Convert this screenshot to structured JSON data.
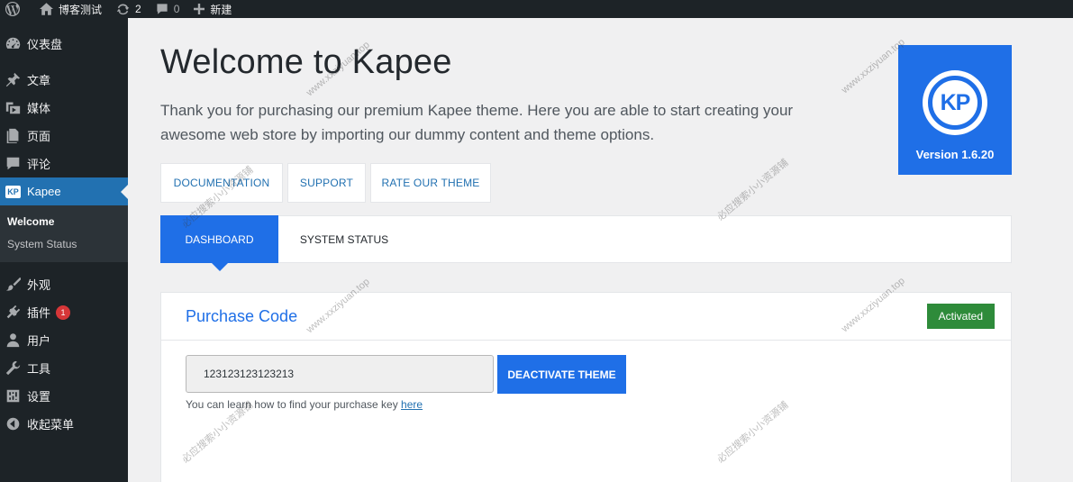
{
  "adminbar": {
    "site_name": "博客测试",
    "updates_count": "2",
    "comments_count": "0",
    "new_label": "新建"
  },
  "sidebar": {
    "items": [
      {
        "label": "仪表盘",
        "icon": "dashboard-icon"
      },
      {
        "label": "文章",
        "icon": "pin-icon"
      },
      {
        "label": "媒体",
        "icon": "media-icon"
      },
      {
        "label": "页面",
        "icon": "page-icon"
      },
      {
        "label": "评论",
        "icon": "comment-icon"
      },
      {
        "label": "Kapee",
        "icon": "kp-icon"
      },
      {
        "label": "外观",
        "icon": "brush-icon"
      },
      {
        "label": "插件",
        "icon": "plugin-icon",
        "badge": "1"
      },
      {
        "label": "用户",
        "icon": "user-icon"
      },
      {
        "label": "工具",
        "icon": "wrench-icon"
      },
      {
        "label": "设置",
        "icon": "settings-icon"
      },
      {
        "label": "收起菜单",
        "icon": "collapse-icon"
      }
    ],
    "kp_mini": "KP",
    "submenu": [
      "Welcome",
      "System Status"
    ]
  },
  "main": {
    "title": "Welcome to Kapee",
    "description": "Thank you for purchasing our premium Kapee theme. Here you are able to start creating your awesome web store by importing our dummy content and theme options.",
    "logo_text": "KP",
    "version": "Version 1.6.20",
    "links": [
      "DOCUMENTATION",
      "SUPPORT",
      "RATE OUR THEME"
    ],
    "tabs": [
      "DASHBOARD",
      "SYSTEM STATUS"
    ],
    "purchase": {
      "title": "Purchase Code",
      "status": "Activated",
      "code": "123123123123213",
      "button": "DEACTIVATE THEME",
      "help_prefix": "You can learn how to find your purchase key ",
      "help_link": "here"
    }
  },
  "watermarks": [
    "www.xxziyuan.top",
    "必应搜索小小资源铺"
  ],
  "colors": {
    "admin_dark": "#1d2327",
    "wp_blue": "#2271b1",
    "kapee_blue": "#1f6fe7",
    "activated_green": "#2e8b3a",
    "badge_red": "#d63638"
  }
}
